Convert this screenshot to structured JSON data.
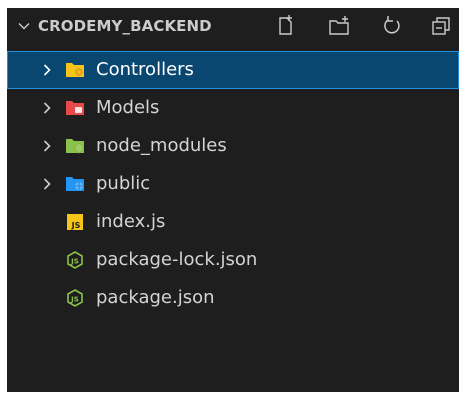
{
  "explorer": {
    "title": "CRODEMY_BACKEND",
    "actions": [
      {
        "name": "new-file-icon"
      },
      {
        "name": "new-folder-icon"
      },
      {
        "name": "refresh-icon"
      },
      {
        "name": "collapse-all-icon"
      }
    ]
  },
  "tree": [
    {
      "label": "Controllers",
      "type": "folder",
      "icon": "folder-controllers-icon",
      "color": "#f5c518",
      "accent": "#e8a020",
      "selected": true
    },
    {
      "label": "Models",
      "type": "folder",
      "icon": "folder-models-icon",
      "color": "#e84a4a",
      "accent": "#ffffff"
    },
    {
      "label": "node_modules",
      "type": "folder",
      "icon": "folder-node-icon",
      "color": "#8bc34a",
      "accent": "#9ccc65"
    },
    {
      "label": "public",
      "type": "folder",
      "icon": "folder-public-icon",
      "color": "#2196f3",
      "accent": "#64b5f6"
    },
    {
      "label": "index.js",
      "type": "file",
      "icon": "javascript-file-icon",
      "color": "#f5c518"
    },
    {
      "label": "package-lock.json",
      "type": "file",
      "icon": "nodejs-file-icon",
      "color": "#8bc34a"
    },
    {
      "label": "package.json",
      "type": "file",
      "icon": "nodejs-file-icon",
      "color": "#8bc34a"
    }
  ],
  "colors": {
    "background": "#1e1e1e",
    "selection": "#094771",
    "selection_border": "#1e90e4",
    "text": "#cccccc"
  }
}
